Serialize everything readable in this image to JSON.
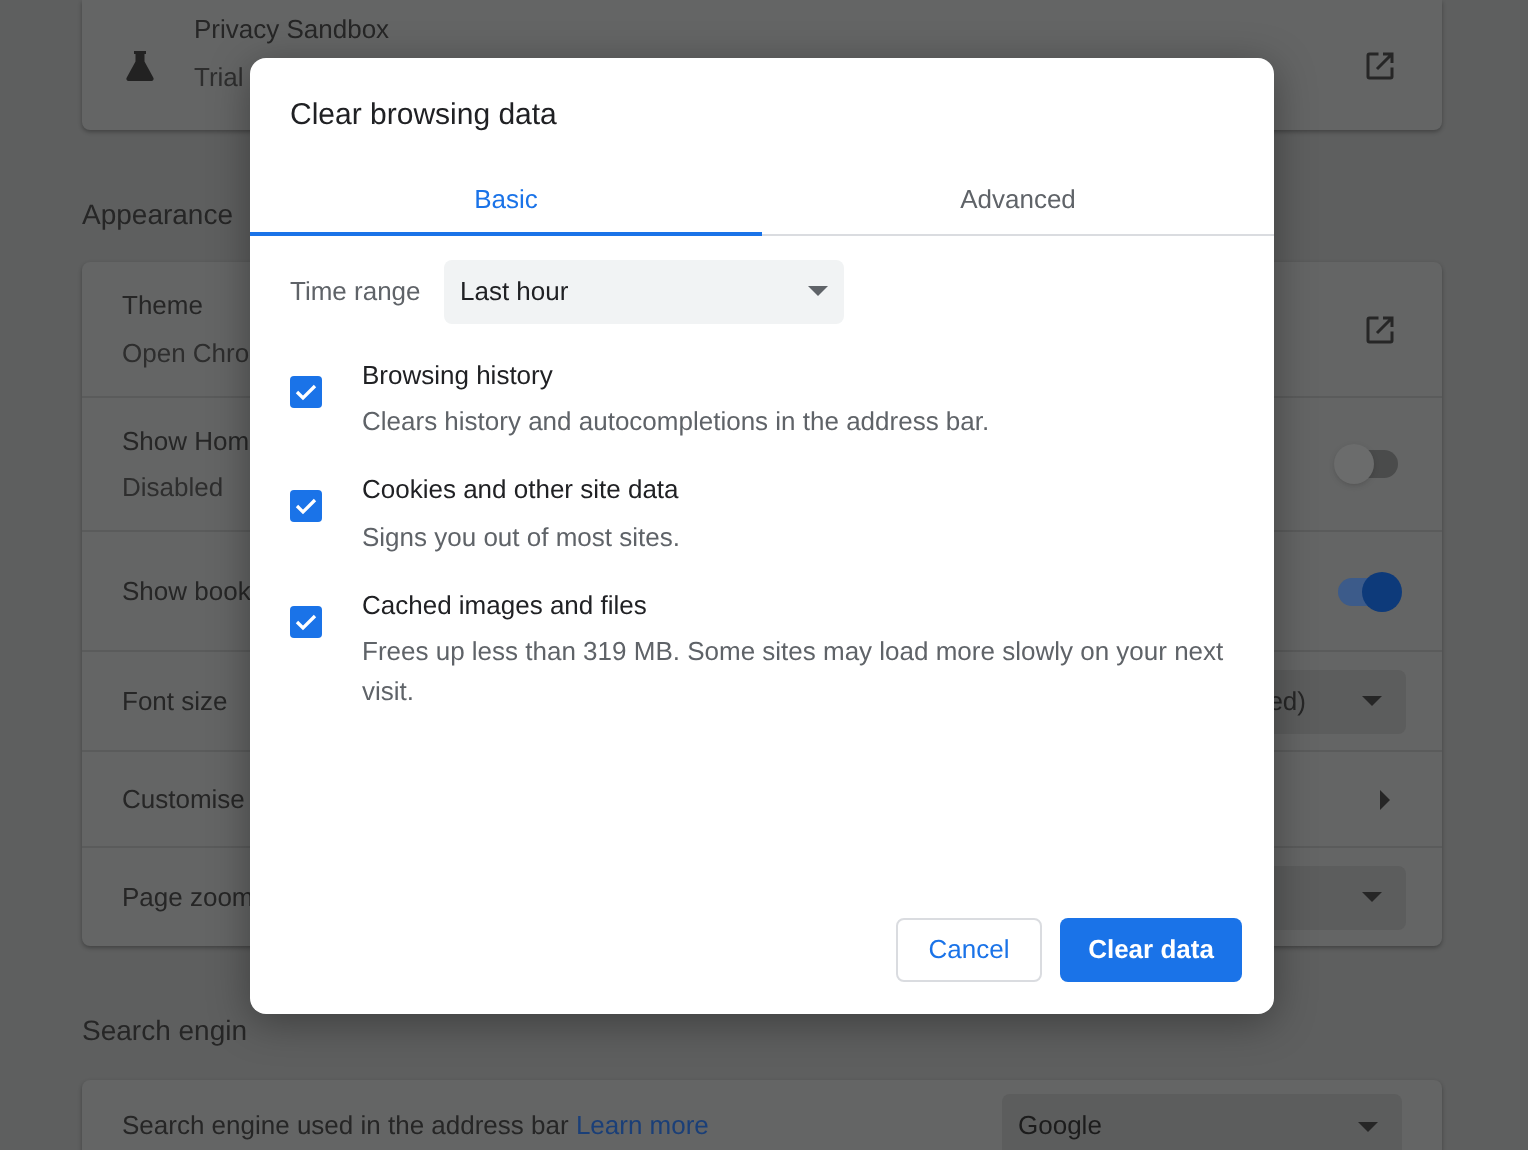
{
  "background": {
    "privacy_card": {
      "title": "Privacy Sandbox",
      "subtitle": "Trial"
    },
    "appearance": {
      "heading": "Appearance",
      "rows": [
        {
          "kind": "link",
          "label": "Theme",
          "sublabel": "Open Chro"
        },
        {
          "kind": "toggle",
          "label": "Show Hom",
          "sublabel": "Disabled",
          "on": false
        },
        {
          "kind": "toggle",
          "label": "Show book",
          "on": true
        },
        {
          "kind": "select",
          "label": "Font size",
          "value": "ed)"
        },
        {
          "kind": "arrow",
          "label": "Customise"
        },
        {
          "kind": "select",
          "label": "Page zoom"
        }
      ]
    },
    "search_engine": {
      "heading": "Search engin",
      "label": "Search engine used in the address bar",
      "link": "Learn more",
      "value": "Google"
    }
  },
  "dialog": {
    "title": "Clear browsing data",
    "tabs": [
      {
        "label": "Basic",
        "selected": true
      },
      {
        "label": "Advanced",
        "selected": false
      }
    ],
    "time_range": {
      "label": "Time range",
      "value": "Last hour"
    },
    "options": [
      {
        "label": "Browsing history",
        "description": "Clears history and autocompletions in the address bar.",
        "checked": true
      },
      {
        "label": "Cookies and other site data",
        "description": "Signs you out of most sites.",
        "checked": true
      },
      {
        "label": "Cached images and files",
        "description": "Frees up less than 319 MB. Some sites may load more slowly on your next visit.",
        "checked": true
      }
    ],
    "buttons": [
      {
        "label": "Cancel",
        "kind": "secondary"
      },
      {
        "label": "Clear data",
        "kind": "primary"
      }
    ]
  }
}
